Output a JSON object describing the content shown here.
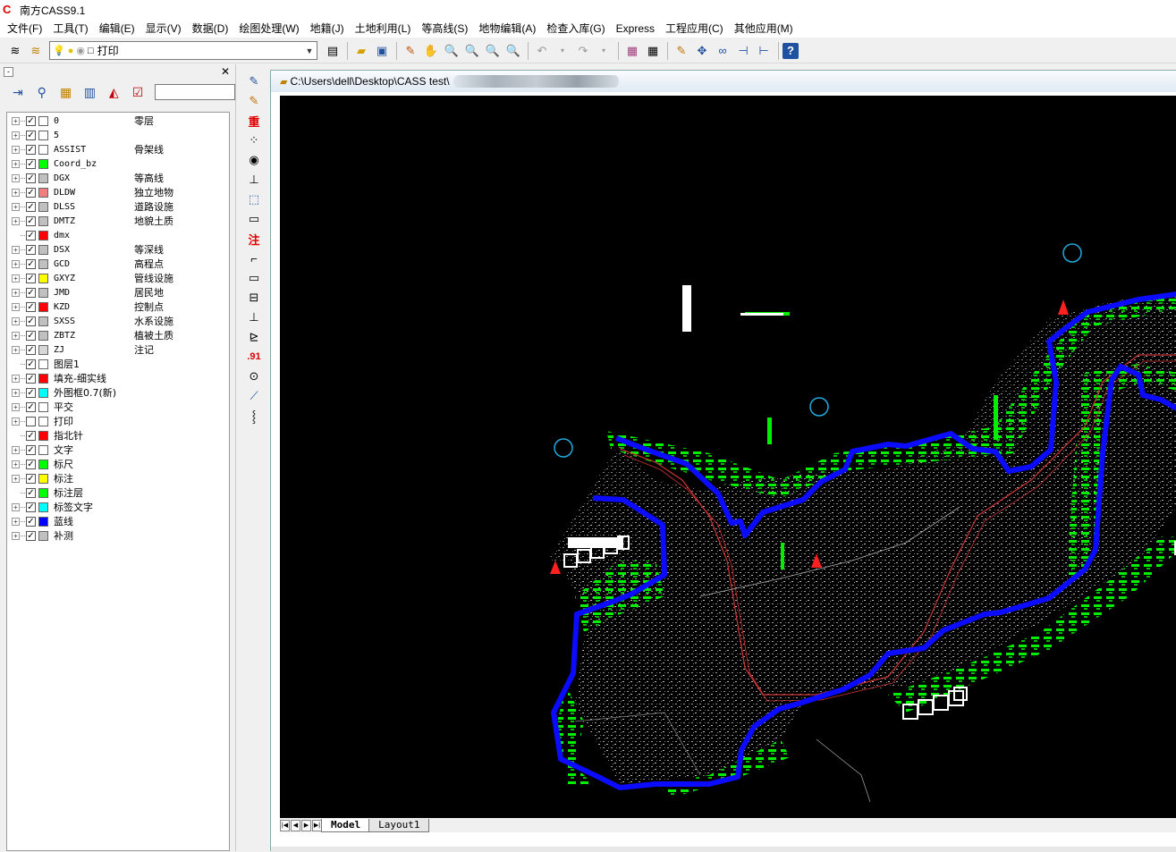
{
  "app": {
    "title": "南方CASS9.1"
  },
  "menu": [
    "文件(F)",
    "工具(T)",
    "编辑(E)",
    "显示(V)",
    "数据(D)",
    "绘图处理(W)",
    "地籍(J)",
    "土地利用(L)",
    "等高线(S)",
    "地物编辑(A)",
    "检查入库(G)",
    "Express",
    "工程应用(C)",
    "其他应用(M)"
  ],
  "toolbar": {
    "layer_combo_value": "打印"
  },
  "layers": [
    {
      "name": "0",
      "desc": "零层",
      "color": "#ffffff",
      "checked": true,
      "expand": true
    },
    {
      "name": "5",
      "desc": "",
      "color": "#ffffff",
      "checked": true,
      "expand": true
    },
    {
      "name": "ASSIST",
      "desc": "骨架线",
      "color": "#ffffff",
      "checked": true,
      "expand": true
    },
    {
      "name": "Coord_bz",
      "desc": "",
      "color": "#00ff00",
      "checked": true,
      "expand": true
    },
    {
      "name": "DGX",
      "desc": "等高线",
      "color": "#c0c0c0",
      "checked": true,
      "expand": true
    },
    {
      "name": "DLDW",
      "desc": "独立地物",
      "color": "#f08080",
      "checked": true,
      "expand": true
    },
    {
      "name": "DLSS",
      "desc": "道路设施",
      "color": "#c0c0c0",
      "checked": true,
      "expand": true
    },
    {
      "name": "DMTZ",
      "desc": "地貌土质",
      "color": "#c0c0c0",
      "checked": true,
      "expand": true
    },
    {
      "name": "dmx",
      "desc": "",
      "color": "#ff0000",
      "checked": true,
      "expand": false
    },
    {
      "name": "DSX",
      "desc": "等深线",
      "color": "#c0c0c0",
      "checked": true,
      "expand": true
    },
    {
      "name": "GCD",
      "desc": "高程点",
      "color": "#c0c0c0",
      "checked": true,
      "expand": true
    },
    {
      "name": "GXYZ",
      "desc": "管线设施",
      "color": "#ffff00",
      "checked": true,
      "expand": true
    },
    {
      "name": "JMD",
      "desc": "居民地",
      "color": "#c0c0c0",
      "checked": true,
      "expand": true
    },
    {
      "name": "KZD",
      "desc": "控制点",
      "color": "#ff0000",
      "checked": true,
      "expand": true
    },
    {
      "name": "SXSS",
      "desc": "水系设施",
      "color": "#c0c0c0",
      "checked": true,
      "expand": true
    },
    {
      "name": "ZBTZ",
      "desc": "植被土质",
      "color": "#c0c0c0",
      "checked": true,
      "expand": true
    },
    {
      "name": "ZJ",
      "desc": "注记",
      "color": "#d8d8d8",
      "checked": true,
      "expand": true
    },
    {
      "name": "图层1",
      "desc": "",
      "color": "#ffffff",
      "checked": true,
      "expand": false
    },
    {
      "name": "填充-细实线",
      "desc": "",
      "color": "#ff0000",
      "checked": true,
      "expand": true
    },
    {
      "name": "外图框0.7(新)",
      "desc": "",
      "color": "#00ffff",
      "checked": true,
      "expand": true
    },
    {
      "name": "平交",
      "desc": "",
      "color": "#ffffff",
      "checked": true,
      "expand": true
    },
    {
      "name": "打印",
      "desc": "",
      "color": "#ffffff",
      "checked": false,
      "expand": true
    },
    {
      "name": "指北针",
      "desc": "",
      "color": "#ff0000",
      "checked": true,
      "expand": false
    },
    {
      "name": "文字",
      "desc": "",
      "color": "#ffffff",
      "checked": true,
      "expand": true
    },
    {
      "name": "标尺",
      "desc": "",
      "color": "#00ff00",
      "checked": true,
      "expand": true
    },
    {
      "name": "标注",
      "desc": "",
      "color": "#ffff00",
      "checked": true,
      "expand": true
    },
    {
      "name": "标注层",
      "desc": "",
      "color": "#00ff00",
      "checked": true,
      "expand": false
    },
    {
      "name": "标签文字",
      "desc": "",
      "color": "#00ffff",
      "checked": true,
      "expand": true
    },
    {
      "name": "蓝线",
      "desc": "",
      "color": "#0000ff",
      "checked": true,
      "expand": true
    },
    {
      "name": "补测",
      "desc": "",
      "color": "#c0c0c0",
      "checked": true,
      "expand": true
    }
  ],
  "side_tools": [
    "重",
    "注",
    ".91"
  ],
  "drawing": {
    "file_path": "C:\\Users\\dell\\Desktop\\CASS test\\"
  },
  "layout_tabs": [
    "Model",
    "Layout1"
  ]
}
